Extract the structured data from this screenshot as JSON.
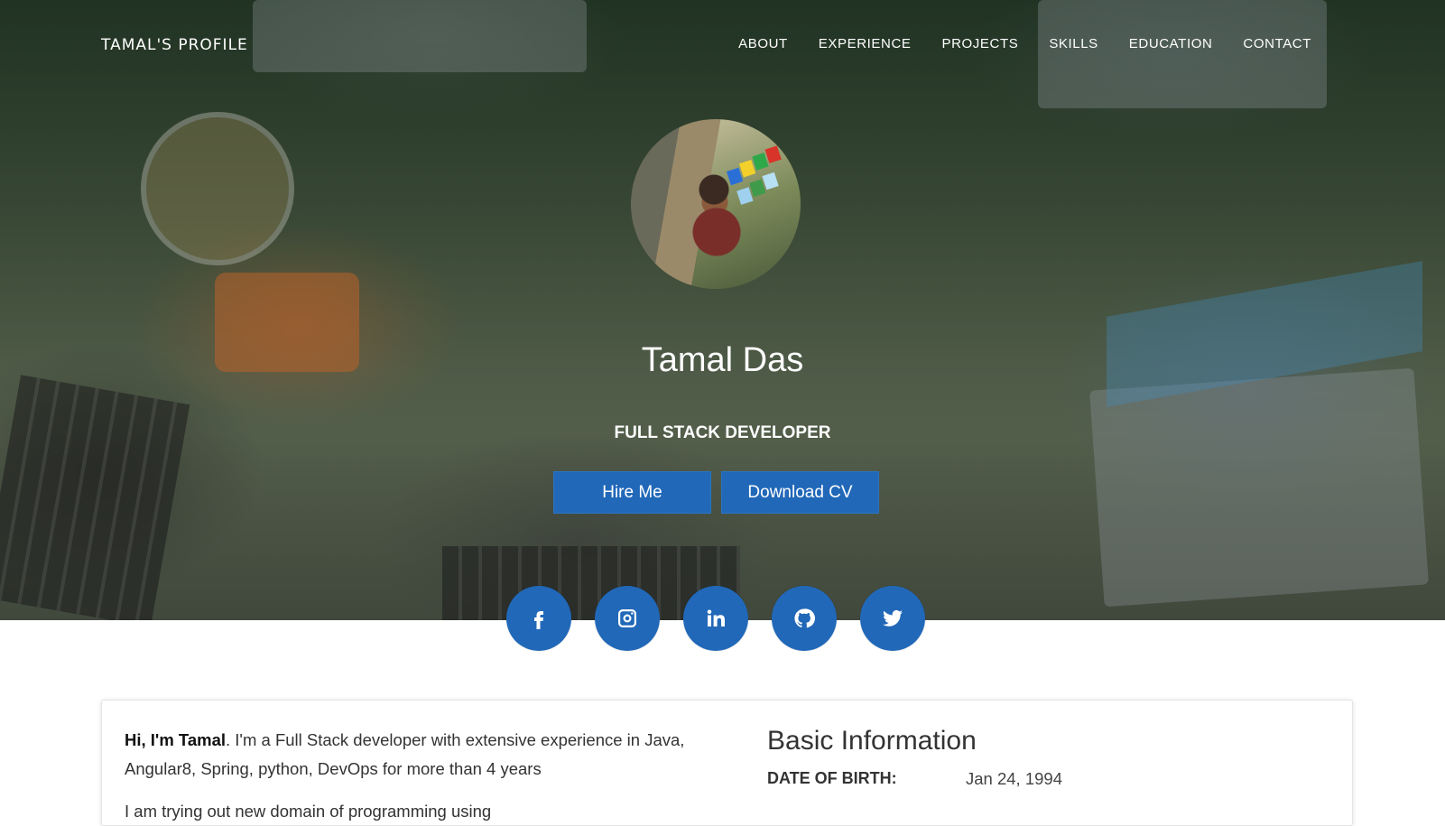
{
  "nav": {
    "brand": "TAMAL'S PROFILE",
    "links": [
      "ABOUT",
      "EXPERIENCE",
      "PROJECTS",
      "SKILLS",
      "EDUCATION",
      "CONTACT"
    ]
  },
  "hero": {
    "name": "Tamal Das",
    "role": "FULL STACK DEVELOPER",
    "hire_label": "Hire Me",
    "cv_label": "Download CV"
  },
  "socials": [
    "facebook-icon",
    "instagram-icon",
    "linkedin-icon",
    "github-icon",
    "twitter-icon"
  ],
  "about": {
    "greeting": "Hi, I'm Tamal",
    "intro": ". I'm a Full Stack developer with extensive experience in Java, Angular8, Spring, python, DevOps for more than 4 years",
    "intro2": "I am trying out new domain of programming using"
  },
  "basic_info": {
    "title": "Basic Information",
    "dob_label": "DATE OF BIRTH:",
    "dob_value": "Jan 24, 1994"
  },
  "colors": {
    "accent": "#2168b8",
    "text": "#333333"
  }
}
